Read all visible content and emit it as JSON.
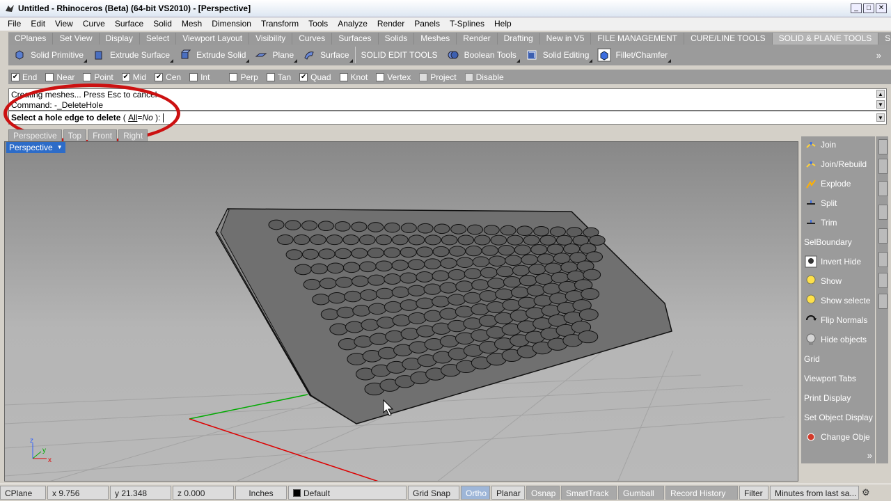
{
  "window": {
    "title": "Untitled - Rhinoceros (Beta) (64-bit VS2010) - [Perspective]",
    "minimize": "_",
    "maximize": "□",
    "close": "✕"
  },
  "menu": [
    "File",
    "Edit",
    "View",
    "Curve",
    "Surface",
    "Solid",
    "Mesh",
    "Dimension",
    "Transform",
    "Tools",
    "Analyze",
    "Render",
    "Panels",
    "T-Splines",
    "Help"
  ],
  "tabs": [
    "CPlanes",
    "Set View",
    "Display",
    "Select",
    "Viewport Layout",
    "Visibility",
    "Curves",
    "Surfaces",
    "Solids",
    "Meshes",
    "Render",
    "Drafting",
    "New in V5",
    "FILE MANAGEMENT",
    "CURE/LINE TOOLS",
    "SOLID & PLANE TOOLS",
    "SURF"
  ],
  "toolbar": {
    "groups": [
      {
        "label": "Solid Primitive",
        "icon": "solid-primitive-icon"
      },
      {
        "label": "Extrude Surface",
        "icon": "extrude-surface-icon"
      },
      {
        "label": "Extrude Solid",
        "icon": "extrude-solid-icon"
      },
      {
        "label": "Plane",
        "icon": "plane-icon"
      },
      {
        "label": "Surface",
        "icon": "surface-icon"
      },
      {
        "label": "SOLID EDIT TOOLS",
        "icon": ""
      },
      {
        "label": "Boolean Tools",
        "icon": "boolean-tools-icon"
      },
      {
        "label": "Solid Editing",
        "icon": "solid-editing-icon"
      },
      {
        "label": "Fillet/Chamfer",
        "icon": "fillet-chamfer-icon"
      }
    ],
    "overflow": "»"
  },
  "osnap": [
    {
      "label": "End",
      "checked": true,
      "enabled": true
    },
    {
      "label": "Near",
      "checked": false,
      "enabled": true
    },
    {
      "label": "Point",
      "checked": false,
      "enabled": true
    },
    {
      "label": "Mid",
      "checked": true,
      "enabled": true
    },
    {
      "label": "Cen",
      "checked": true,
      "enabled": true
    },
    {
      "label": "Int",
      "checked": false,
      "enabled": true
    },
    {
      "label": "Perp",
      "checked": false,
      "enabled": true
    },
    {
      "label": "Tan",
      "checked": false,
      "enabled": true
    },
    {
      "label": "Quad",
      "checked": true,
      "enabled": true
    },
    {
      "label": "Knot",
      "checked": false,
      "enabled": true
    },
    {
      "label": "Vertex",
      "checked": false,
      "enabled": true
    },
    {
      "label": "Project",
      "checked": false,
      "enabled": false
    },
    {
      "label": "Disable",
      "checked": false,
      "enabled": false
    }
  ],
  "command": {
    "line1": "Creating meshes... Press Esc to cancel",
    "line2": "Command: -_DeleteHole",
    "prompt": "Select a hole edge to delete",
    "option_open": " ( ",
    "option_name": "All",
    "option_eq": "=",
    "option_value": "No",
    "option_close": " ):"
  },
  "viewport_tabs": [
    "Perspective",
    "Top",
    "Front",
    "Right"
  ],
  "viewport": {
    "name": "Perspective",
    "axis_x": "x",
    "axis_y": "y",
    "axis_z": "z"
  },
  "right_panel": [
    {
      "label": "Join",
      "icon": "join-icon"
    },
    {
      "label": "Join/Rebuild",
      "icon": "join-rebuild-icon"
    },
    {
      "label": "Explode",
      "icon": "explode-icon"
    },
    {
      "label": "Split",
      "icon": "split-icon"
    },
    {
      "label": "Trim",
      "icon": "trim-icon"
    },
    {
      "label": "SelBoundary",
      "icon": ""
    },
    {
      "label": "Invert Hide",
      "icon": "invert-hide-icon"
    },
    {
      "label": "Show",
      "icon": "show-icon"
    },
    {
      "label": "Show selecte",
      "icon": "show-selected-icon"
    },
    {
      "label": "Flip Normals",
      "icon": "flip-normals-icon"
    },
    {
      "label": "Hide objects",
      "icon": "hide-objects-icon"
    },
    {
      "label": "Grid",
      "icon": ""
    },
    {
      "label": "Viewport Tabs",
      "icon": ""
    },
    {
      "label": "Print Display",
      "icon": ""
    },
    {
      "label": "Set Object Display",
      "icon": ""
    },
    {
      "label": "Change Obje",
      "icon": "change-object-icon"
    }
  ],
  "right_panel_overflow": "»",
  "status": {
    "cplane": "CPlane",
    "x": "x 9.756",
    "y": "y 21.348",
    "z": "z 0.000",
    "units": "Inches",
    "layer": "Default",
    "grid_snap": "Grid Snap",
    "ortho": "Ortho",
    "planar": "Planar",
    "osnap": "Osnap",
    "smarttrack": "SmartTrack",
    "gumball": "Gumball",
    "record_history": "Record History",
    "filter": "Filter",
    "minutes": "Minutes from last sa..."
  },
  "colors": {
    "red_annotation": "#cc1111",
    "viewport_tab_active": "#2d6cc8",
    "x_axis": "#dd0000",
    "y_axis": "#00aa00"
  }
}
